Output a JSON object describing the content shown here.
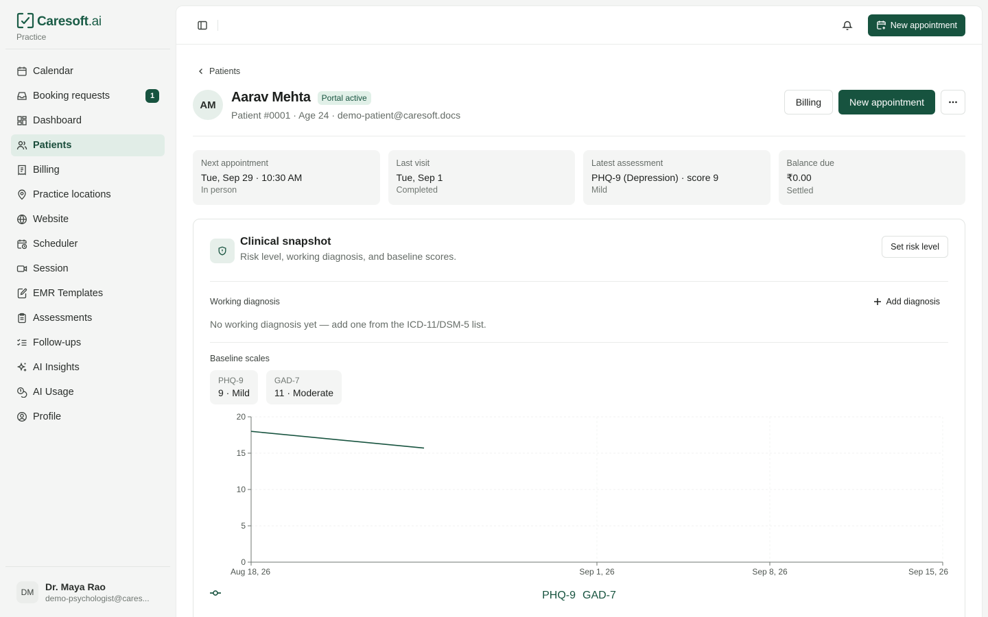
{
  "brand": {
    "name": "Caresoft",
    "suffix": ".ai",
    "subtitle": "Practice",
    "color": "#1a5c46"
  },
  "sidebar": {
    "items": [
      {
        "label": "Calendar",
        "icon": "calendar-icon"
      },
      {
        "label": "Booking requests",
        "icon": "inbox-icon",
        "badge": "1"
      },
      {
        "label": "Dashboard",
        "icon": "dashboard-icon"
      },
      {
        "label": "Patients",
        "icon": "users-icon",
        "active": true
      },
      {
        "label": "Billing",
        "icon": "receipt-icon"
      },
      {
        "label": "Practice locations",
        "icon": "map-pin-icon"
      },
      {
        "label": "Website",
        "icon": "globe-icon"
      },
      {
        "label": "Scheduler",
        "icon": "calendar-clock-icon"
      },
      {
        "label": "Session",
        "icon": "video-icon"
      },
      {
        "label": "EMR Templates",
        "icon": "file-edit-icon"
      },
      {
        "label": "Assessments",
        "icon": "clipboard-icon"
      },
      {
        "label": "Follow-ups",
        "icon": "list-checks-icon"
      },
      {
        "label": "AI Insights",
        "icon": "sparkles-icon"
      },
      {
        "label": "AI Usage",
        "icon": "coins-icon"
      },
      {
        "label": "Profile",
        "icon": "user-circle-icon"
      }
    ]
  },
  "user": {
    "initials": "DM",
    "name": "Dr. Maya Rao",
    "email": "demo-psychologist@cares..."
  },
  "topbar": {
    "new_appointment": "New appointment"
  },
  "breadcrumb": {
    "back_label": "Patients"
  },
  "patient": {
    "initials": "AM",
    "name": "Aarav Mehta",
    "status": "Portal active",
    "meta": "Patient #0001 · Age 24 · demo-patient@caresoft.docs"
  },
  "header_actions": {
    "billing": "Billing",
    "new_appointment": "New appointment"
  },
  "stats": [
    {
      "label": "Next appointment",
      "value": "Tue, Sep 29 · 10:30 AM",
      "sub": "In person"
    },
    {
      "label": "Last visit",
      "value": "Tue, Sep 1",
      "sub": "Completed"
    },
    {
      "label": "Latest assessment",
      "value": "PHQ-9 (Depression) · score 9",
      "sub": "Mild"
    },
    {
      "label": "Balance due",
      "value": "₹0.00",
      "sub": "Settled"
    }
  ],
  "snapshot": {
    "title": "Clinical snapshot",
    "subtitle": "Risk level, working diagnosis, and baseline scores.",
    "set_risk": "Set risk level",
    "diagnosis_label": "Working diagnosis",
    "add_diagnosis": "Add diagnosis",
    "diagnosis_empty": "No working diagnosis yet — add one from the ICD-11/DSM-5 list.",
    "baseline_label": "Baseline scales",
    "chips": [
      {
        "label": "PHQ-9",
        "value": "9 · Mild"
      },
      {
        "label": "GAD-7",
        "value": "11 · Moderate"
      }
    ]
  },
  "chart_data": {
    "type": "line",
    "x_ticks": [
      "Aug 18, 26",
      "Sep 1, 26",
      "Sep 8, 26",
      "Sep 15, 26"
    ],
    "y_ticks": [
      0,
      5,
      10,
      15,
      20
    ],
    "ylim": [
      0,
      20
    ],
    "grid": true,
    "legend": "bottom-center",
    "series": [
      {
        "name": "PHQ-9",
        "points": [
          {
            "x": "Aug 18, 26",
            "y": 18
          },
          {
            "x": "Aug 25, 26",
            "y": 15.7
          }
        ]
      },
      {
        "name": "GAD-7",
        "points": []
      }
    ],
    "color": "#17533f"
  }
}
